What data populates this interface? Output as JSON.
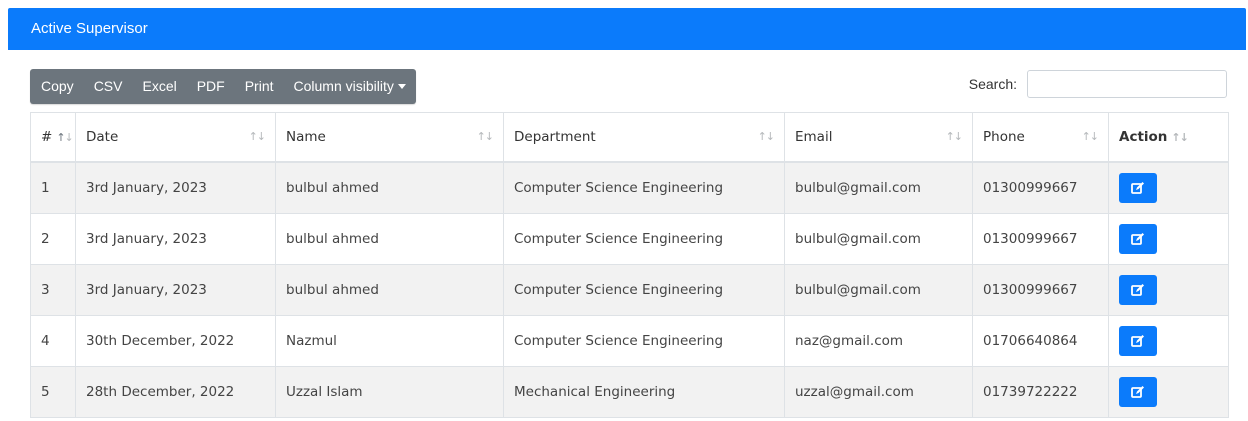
{
  "header": {
    "title": "Active Supervisor"
  },
  "toolbar": {
    "buttons": [
      "Copy",
      "CSV",
      "Excel",
      "PDF",
      "Print",
      "Column visibility"
    ]
  },
  "search": {
    "label": "Search:",
    "value": "",
    "placeholder": ""
  },
  "table": {
    "columns": [
      "#",
      "Date",
      "Name",
      "Department",
      "Email",
      "Phone",
      "Action"
    ],
    "rows": [
      {
        "num": "1",
        "date": "3rd January, 2023",
        "name": "bulbul ahmed",
        "department": "Computer Science Engineering",
        "email": "bulbul@gmail.com",
        "phone": "01300999667"
      },
      {
        "num": "2",
        "date": "3rd January, 2023",
        "name": "bulbul ahmed",
        "department": "Computer Science Engineering",
        "email": "bulbul@gmail.com",
        "phone": "01300999667"
      },
      {
        "num": "3",
        "date": "3rd January, 2023",
        "name": "bulbul ahmed",
        "department": "Computer Science Engineering",
        "email": "bulbul@gmail.com",
        "phone": "01300999667"
      },
      {
        "num": "4",
        "date": "30th December, 2022",
        "name": "Nazmul",
        "department": "Computer Science Engineering",
        "email": "naz@gmail.com",
        "phone": "01706640864"
      },
      {
        "num": "5",
        "date": "28th December, 2022",
        "name": "Uzzal Islam",
        "department": "Mechanical Engineering",
        "email": "uzzal@gmail.com",
        "phone": "01739722222"
      }
    ]
  },
  "icons": {
    "sort": "sort-arrows-icon",
    "edit": "edit-icon",
    "caret": "caret-down-icon"
  },
  "colors": {
    "primary": "#0b7bfb",
    "toolbar": "#6c757d",
    "stripe": "#f2f2f2"
  }
}
